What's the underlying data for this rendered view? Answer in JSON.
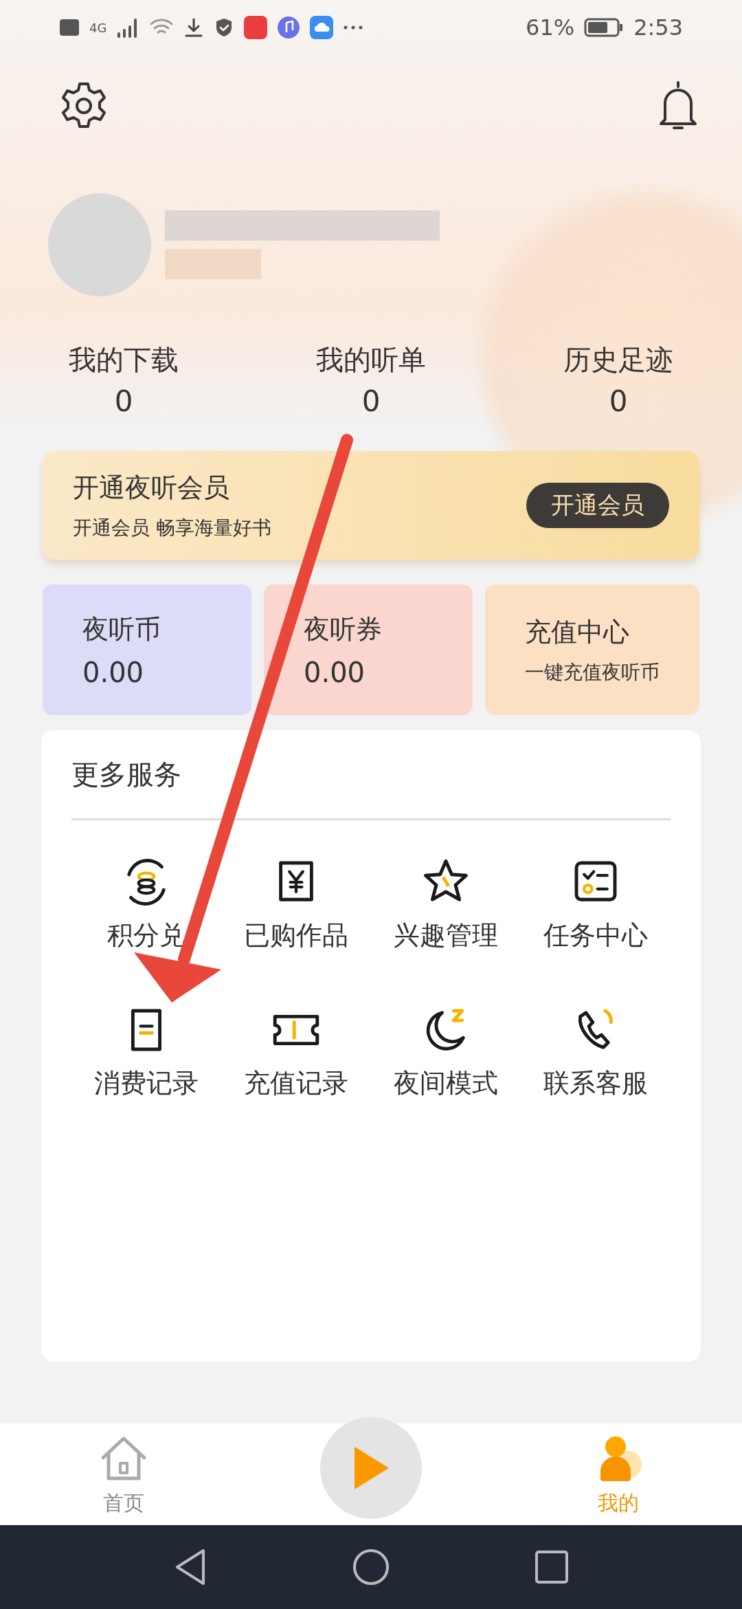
{
  "status_bar": {
    "network": "4G",
    "battery_text": "61%",
    "time": "2:53"
  },
  "profile": {
    "stats": [
      {
        "label": "我的下载",
        "value": "0"
      },
      {
        "label": "我的听单",
        "value": "0"
      },
      {
        "label": "历史足迹",
        "value": "0"
      }
    ]
  },
  "vip_banner": {
    "title": "开通夜听会员",
    "subtitle": "开通会员 畅享海量好书",
    "button": "开通会员"
  },
  "wallet": [
    {
      "kind": "balance",
      "title": "夜听币",
      "value": "0.00",
      "color": "#dcdcf8"
    },
    {
      "kind": "balance",
      "title": "夜听券",
      "value": "0.00",
      "color": "#fad6ce"
    },
    {
      "kind": "action",
      "title": "充值中心",
      "value": "一键充值夜听币",
      "color": "#fbe0c4"
    }
  ],
  "services": {
    "title": "更多服务",
    "items": [
      {
        "kind": "points",
        "label": "积分兑"
      },
      {
        "kind": "purchased",
        "label": "已购作品"
      },
      {
        "kind": "interest",
        "label": "兴趣管理"
      },
      {
        "kind": "tasks",
        "label": "任务中心"
      },
      {
        "kind": "spending",
        "label": "消费记录"
      },
      {
        "kind": "recharge",
        "label": "充值记录"
      },
      {
        "kind": "night",
        "label": "夜间模式"
      },
      {
        "kind": "contact",
        "label": "联系客服"
      }
    ]
  },
  "tab_bar": [
    {
      "kind": "home",
      "label": "首页",
      "selected": false
    },
    {
      "kind": "play"
    },
    {
      "kind": "me",
      "label": "我的",
      "selected": true
    }
  ]
}
